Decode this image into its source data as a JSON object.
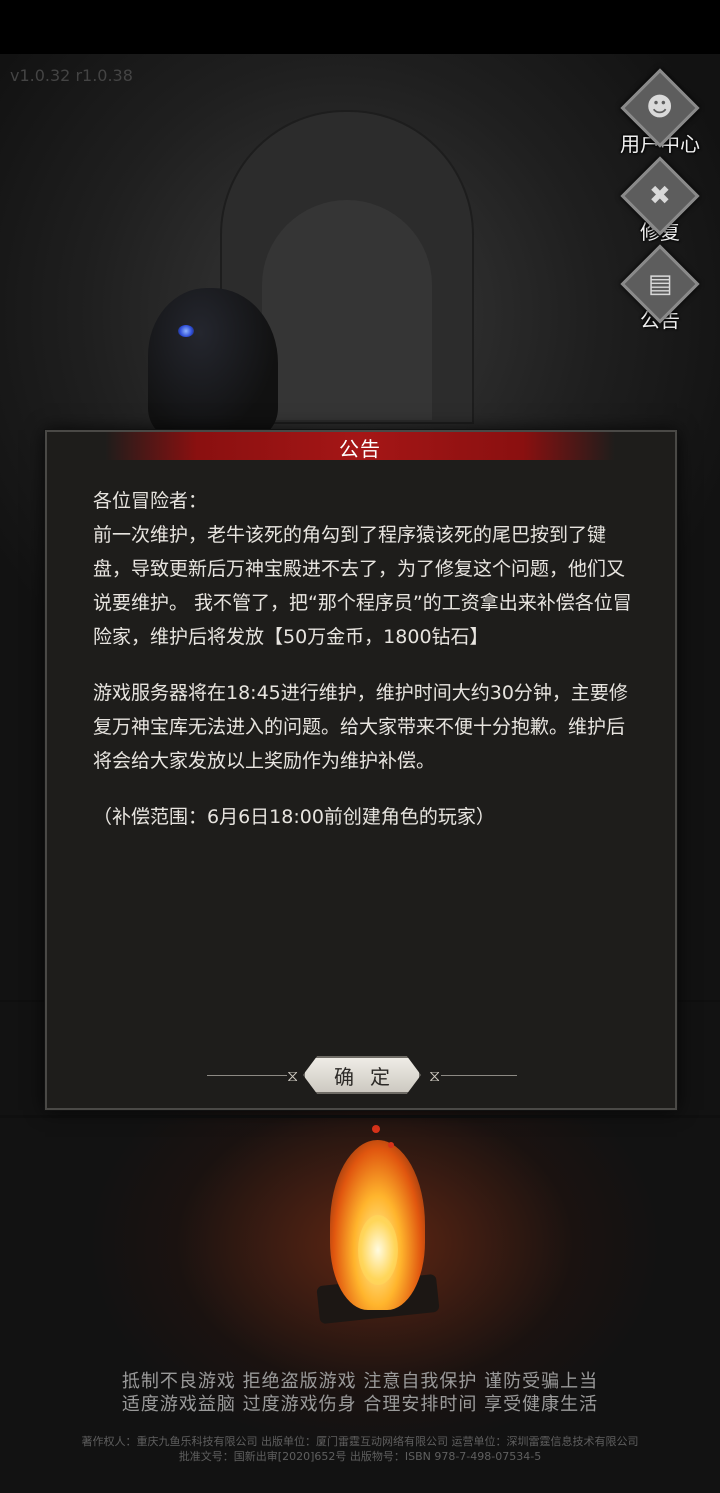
{
  "version": "v1.0.32 r1.0.38",
  "side_menu": [
    {
      "label": "用户中心",
      "icon": "user-icon"
    },
    {
      "label": "修复",
      "icon": "repair-icon"
    },
    {
      "label": "公告",
      "icon": "notice-icon"
    }
  ],
  "dialog": {
    "title": "公告",
    "greeting": "各位冒险者：",
    "paragraph1": "前一次维护，老牛该死的角勾到了程序猿该死的尾巴按到了键盘，导致更新后万神宝殿进不去了，为了修复这个问题，他们又说要维护。 我不管了，把“那个程序员”的工资拿出来补偿各位冒险家，维护后将发放【50万金币，1800钻石】",
    "paragraph2": "游戏服务器将在18:45进行维护，维护时间大约30分钟，主要修复万神宝库无法进入的问题。给大家带来不便十分抱歉。维护后将会给大家发放以上奖励作为维护补偿。",
    "note": "（补偿范围：6月6日18:00前创建角色的玩家）",
    "confirm_label": "确定"
  },
  "health_notice": {
    "line1": "抵制不良游戏 拒绝盗版游戏 注意自我保护 谨防受骗上当",
    "line2": "适度游戏益脑 过度游戏伤身 合理安排时间 享受健康生活"
  },
  "copyright": {
    "line1": "著作权人：重庆九鱼乐科技有限公司 出版单位：厦门雷霆互动网络有限公司 运营单位：深圳雷霆信息技术有限公司",
    "line2": "批准文号：国新出审[2020]652号 出版物号：ISBN 978-7-498-07534-5"
  }
}
